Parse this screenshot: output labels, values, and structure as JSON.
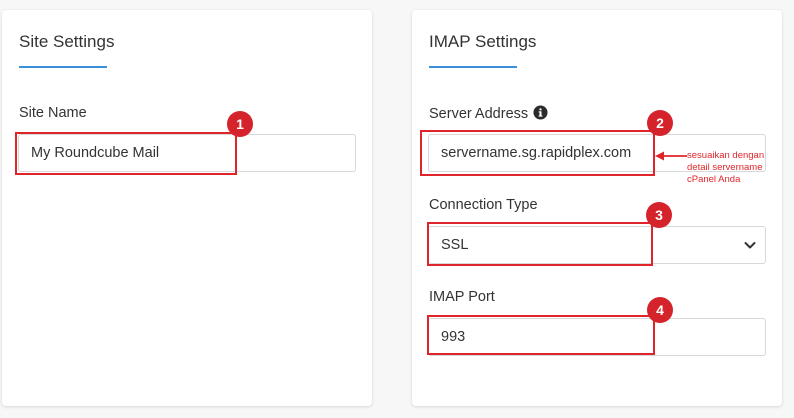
{
  "site_settings": {
    "title": "Site Settings",
    "site_name_label": "Site Name",
    "site_name_value": "My Roundcube Mail"
  },
  "imap_settings": {
    "title": "IMAP Settings",
    "server_address_label": "Server Address",
    "server_address_value": "servername.sg.rapidplex.com",
    "connection_type_label": "Connection Type",
    "connection_type_value": "SSL",
    "imap_port_label": "IMAP Port",
    "imap_port_value": "993"
  },
  "annotations": {
    "badges": [
      "1",
      "2",
      "3",
      "4"
    ],
    "note_lines": [
      "sesuaikan dengan",
      "detail servername",
      "cPanel Anda"
    ],
    "highlight_color": "#e0252a"
  },
  "colors": {
    "accent_underline": "#3b8fd9",
    "badge_fill": "#d4232a"
  },
  "icons": {
    "info": "info-icon",
    "select_arrow": "chevron-down-icon"
  }
}
